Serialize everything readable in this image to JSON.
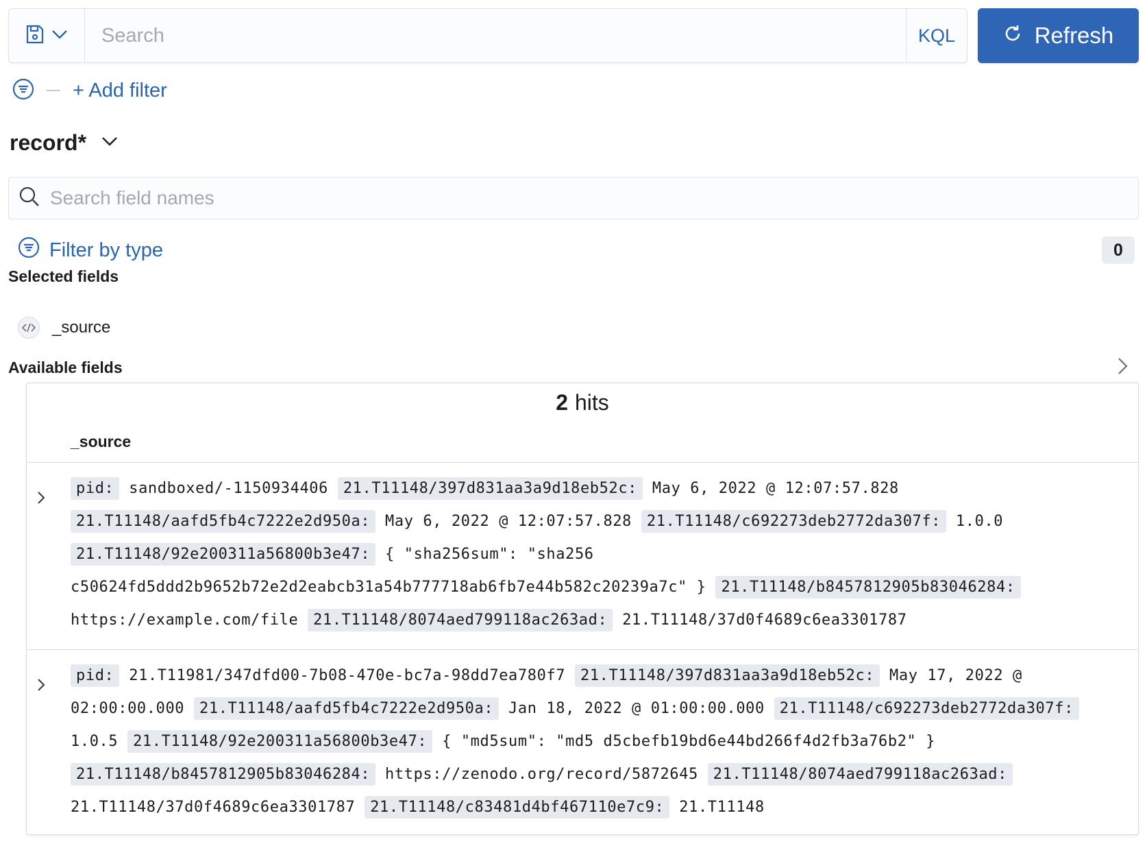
{
  "query_bar": {
    "search_placeholder": "Search",
    "language_label": "KQL",
    "refresh_label": "Refresh"
  },
  "filters": {
    "add_filter_label": "+ Add filter"
  },
  "sidebar": {
    "index_pattern": "record*",
    "field_search_placeholder": "Search field names",
    "filter_by_type_label": "Filter by type",
    "filter_count": "0",
    "selected_fields_title": "Selected fields",
    "selected_fields": [
      "_source"
    ],
    "available_fields_title": "Available fields"
  },
  "results": {
    "hits_count": "2",
    "hits_label": "hits",
    "column_header": "_source",
    "documents": [
      [
        {
          "k": "pid:",
          "v": "sandboxed/-1150934406"
        },
        {
          "k": "21.T11148/397d831aa3a9d18eb52c:",
          "v": "May 6, 2022 @ 12:07:57.828"
        },
        {
          "k": "21.T11148/aafd5fb4c7222e2d950a:",
          "v": "May 6, 2022 @ 12:07:57.828"
        },
        {
          "k": "21.T11148/c692273deb2772da307f:",
          "v": "1.0.0"
        },
        {
          "k": "21.T11148/92e200311a56800b3e47:",
          "v": "{ \"sha256sum\": \"sha256 c50624fd5ddd2b9652b72e2d2eabcb31a54b777718ab6fb7e44b582c20239a7c\" }"
        },
        {
          "k": "21.T11148/b8457812905b83046284:",
          "v": "https://example.com/file"
        },
        {
          "k": "21.T11148/8074aed799118ac263ad:",
          "v": "21.T11148/37d0f4689c6ea3301787"
        }
      ],
      [
        {
          "k": "pid:",
          "v": "21.T11981/347dfd00-7b08-470e-bc7a-98dd7ea780f7"
        },
        {
          "k": "21.T11148/397d831aa3a9d18eb52c:",
          "v": "May 17, 2022 @ 02:00:00.000"
        },
        {
          "k": "21.T11148/aafd5fb4c7222e2d950a:",
          "v": "Jan 18, 2022 @ 01:00:00.000"
        },
        {
          "k": "21.T11148/c692273deb2772da307f:",
          "v": "1.0.5"
        },
        {
          "k": "21.T11148/92e200311a56800b3e47:",
          "v": "{ \"md5sum\": \"md5 d5cbefb19bd6e44bd266f4d2fb3a76b2\" }"
        },
        {
          "k": "21.T11148/b8457812905b83046284:",
          "v": "https://zenodo.org/record/5872645"
        },
        {
          "k": "21.T11148/8074aed799118ac263ad:",
          "v": "21.T11148/37d0f4689c6ea3301787"
        },
        {
          "k": "21.T11148/c83481d4bf467110e7c9:",
          "v": "21.T11148"
        }
      ]
    ]
  }
}
